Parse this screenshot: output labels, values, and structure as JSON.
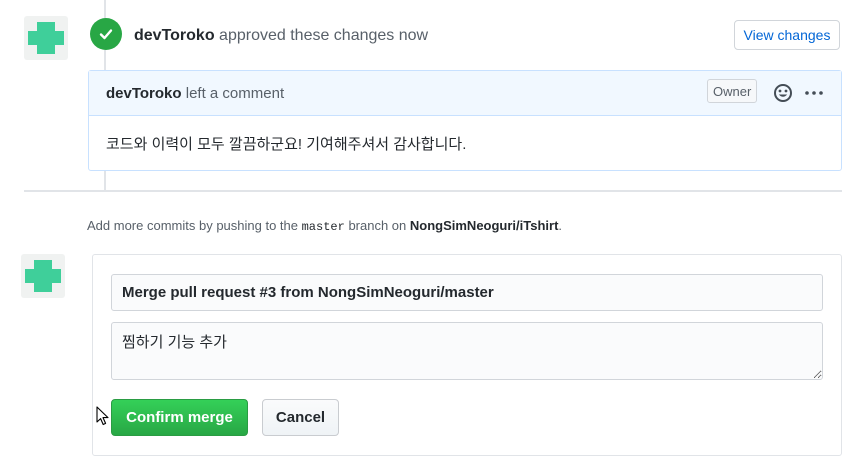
{
  "colors": {
    "accent_green": "#28a745",
    "avatar_teal": "#3fcf9a",
    "link_blue": "#0366d6"
  },
  "review_event": {
    "icon": "check-icon",
    "author": "devToroko",
    "action_text": " approved these changes now",
    "view_changes_label": "View changes"
  },
  "comment": {
    "author": "devToroko",
    "action_text": " left a comment",
    "role_badge": "Owner",
    "reaction_icon": "smiley-icon",
    "more_icon": "kebab-horizontal-icon",
    "body": "코드와 이력이 모두 깔끔하군요! 기여해주셔서 감사합니다."
  },
  "merge_hint": {
    "prefix": "Add more commits by pushing to the ",
    "branch": "master",
    "middle": " branch on ",
    "repo": "NongSimNeoguri/iTshirt",
    "suffix": "."
  },
  "merge_form": {
    "title_value": "Merge pull request #3 from NongSimNeoguri/master",
    "body_value": "찜하기 기능 추가",
    "confirm_label": "Confirm merge",
    "cancel_label": "Cancel"
  }
}
